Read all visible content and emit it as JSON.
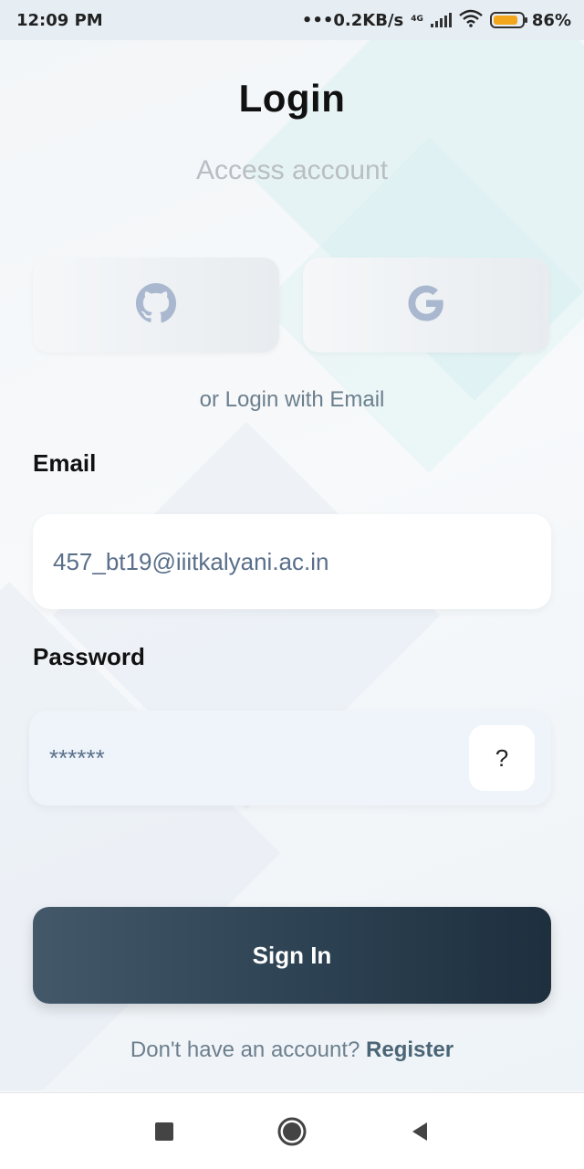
{
  "status_bar": {
    "time": "12:09 PM",
    "network_speed": "0.2KB/s",
    "network_type": "4G",
    "battery": "86%"
  },
  "login": {
    "title": "Login",
    "subtitle": "Access account",
    "social": [
      {
        "name": "github",
        "icon": "github-icon"
      },
      {
        "name": "google",
        "icon": "google-icon"
      }
    ],
    "divider_text": "or Login with Email",
    "email_label": "Email",
    "email_value": "457_bt19@iiitkalyani.ac.in",
    "password_label": "Password",
    "password_value": "******",
    "help_button": "?",
    "signin_label": "Sign In",
    "register_prompt": "Don't have an account?",
    "register_link": "Register"
  },
  "colors": {
    "primary_button": "#2c4152",
    "battery_fill": "#f3a61b",
    "icon_tint": "#a9b8cf"
  }
}
